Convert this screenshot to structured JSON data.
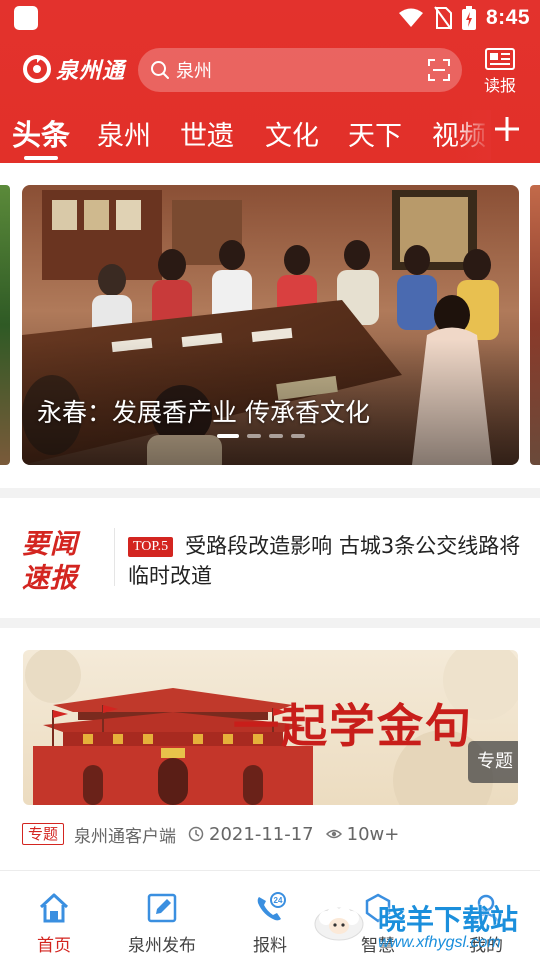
{
  "colors": {
    "brand_red": "#e3322d",
    "flash_red": "#d32520",
    "watermark_blue": "#1b8fdc"
  },
  "status_bar": {
    "time": "8:45",
    "icons": [
      "wifi-icon",
      "no-sim-icon",
      "battery-charging-icon"
    ]
  },
  "header": {
    "app_name": "泉州通",
    "search_placeholder": "泉州",
    "read_label": "读报"
  },
  "tabs": [
    {
      "label": "头条",
      "active": true
    },
    {
      "label": "泉州"
    },
    {
      "label": "世遗"
    },
    {
      "label": "文化"
    },
    {
      "label": "天下"
    },
    {
      "label": "视频"
    }
  ],
  "banner": {
    "caption": "永春：发展香产业  传承香文化",
    "slide_count": 4,
    "active_slide": 1
  },
  "news_flash": {
    "logo_line1": "要闻",
    "logo_line2": "速报",
    "badge": "TOP.5",
    "headline": "受路段改造影响  古城3条公交线路将临时改道"
  },
  "feature_card": {
    "image_title": "一起学金句",
    "image_tag": "专题",
    "meta_tag": "专题",
    "source": "泉州通客户端",
    "date": "2021-11-17",
    "views": "10w+"
  },
  "bottom_nav": [
    {
      "label": "首页",
      "icon": "home-icon",
      "active": true
    },
    {
      "label": "泉州发布",
      "icon": "edit-icon"
    },
    {
      "label": "报料",
      "icon": "phone-24-icon"
    },
    {
      "label": "智慧",
      "icon": "service-icon"
    },
    {
      "label": "我的",
      "icon": "user-icon"
    }
  ],
  "watermark": {
    "text": "晓羊下载站",
    "url": "www.xfhygsl.com"
  }
}
